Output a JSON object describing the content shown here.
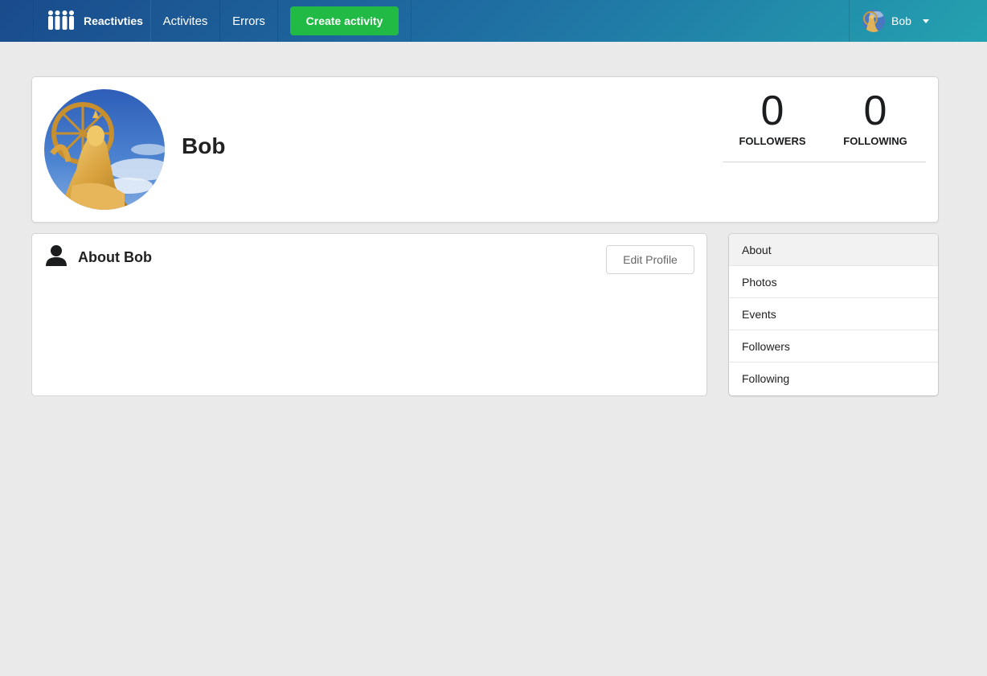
{
  "navbar": {
    "brand": "Reactivties",
    "links": [
      "Activites",
      "Errors"
    ],
    "create_button": "Create activity",
    "user_name": "Bob"
  },
  "profile": {
    "name": "Bob",
    "followers_count": "0",
    "followers_label": "FOLLOWERS",
    "following_count": "0",
    "following_label": "FOLLOWING"
  },
  "about": {
    "title": "About Bob",
    "edit_button": "Edit Profile"
  },
  "side_menu": {
    "items": [
      "About",
      "Photos",
      "Events",
      "Followers",
      "Following"
    ],
    "active": "About"
  },
  "colors": {
    "nav_start": "#1a4b8c",
    "nav_end": "#24a2b0",
    "create_green": "#21ba45",
    "page_bg": "#eaeaea"
  },
  "icons": {
    "brand": "people-logo-icon",
    "user_caret": "caret-down-icon",
    "about": "user-icon"
  }
}
